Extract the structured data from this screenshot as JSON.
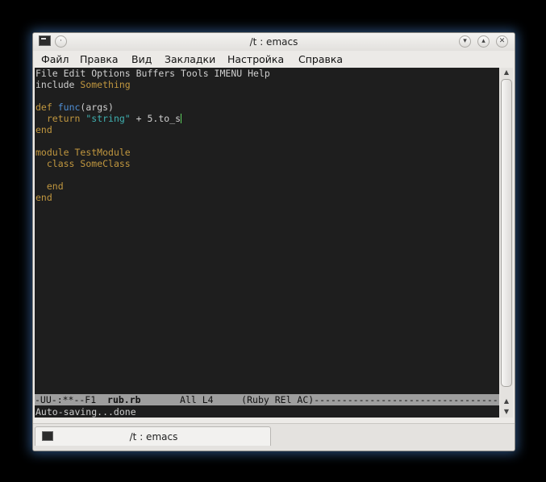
{
  "window": {
    "title": "/t : emacs"
  },
  "menubar": {
    "items": [
      "Файл",
      "Правка",
      "Вид",
      "Закладки",
      "Настройка",
      "Справка"
    ]
  },
  "emacs": {
    "menu_line": "File Edit Options Buffers Tools IMENU Help",
    "code": {
      "l1_kw": "include",
      "l1_id": "Something",
      "l3_kw": "def",
      "l3_fn": "func",
      "l3_args": "(args)",
      "l4_kw": "return",
      "l4_str": "\"string\"",
      "l4_rest": " + 5.to_s",
      "l5_kw": "end",
      "l7_kw": "module",
      "l7_id": "TestModule",
      "l8_kw": "class",
      "l8_id": "SomeClass",
      "l10_kw": "end",
      "l11_kw": "end"
    },
    "modeline": {
      "prefix": "-UU-:**--F1  ",
      "buffer": "rub.rb",
      "suffix": "       All L4     (Ruby REl AC)------------------------------------"
    },
    "echo": "Auto-saving...done"
  },
  "tabbar": {
    "tab_label": "/t : emacs"
  },
  "colors": {
    "background": "#000000",
    "editor_bg": "#1e1e1e",
    "keyword": "#c1973f",
    "function": "#4f8fd6",
    "string": "#3fb0b0",
    "cursor": "#5ed05e",
    "modeline_bg": "#9e9e9e"
  },
  "icons": [
    "terminal-icon",
    "menu-icon",
    "minimize-icon",
    "maximize-icon",
    "close-icon"
  ]
}
